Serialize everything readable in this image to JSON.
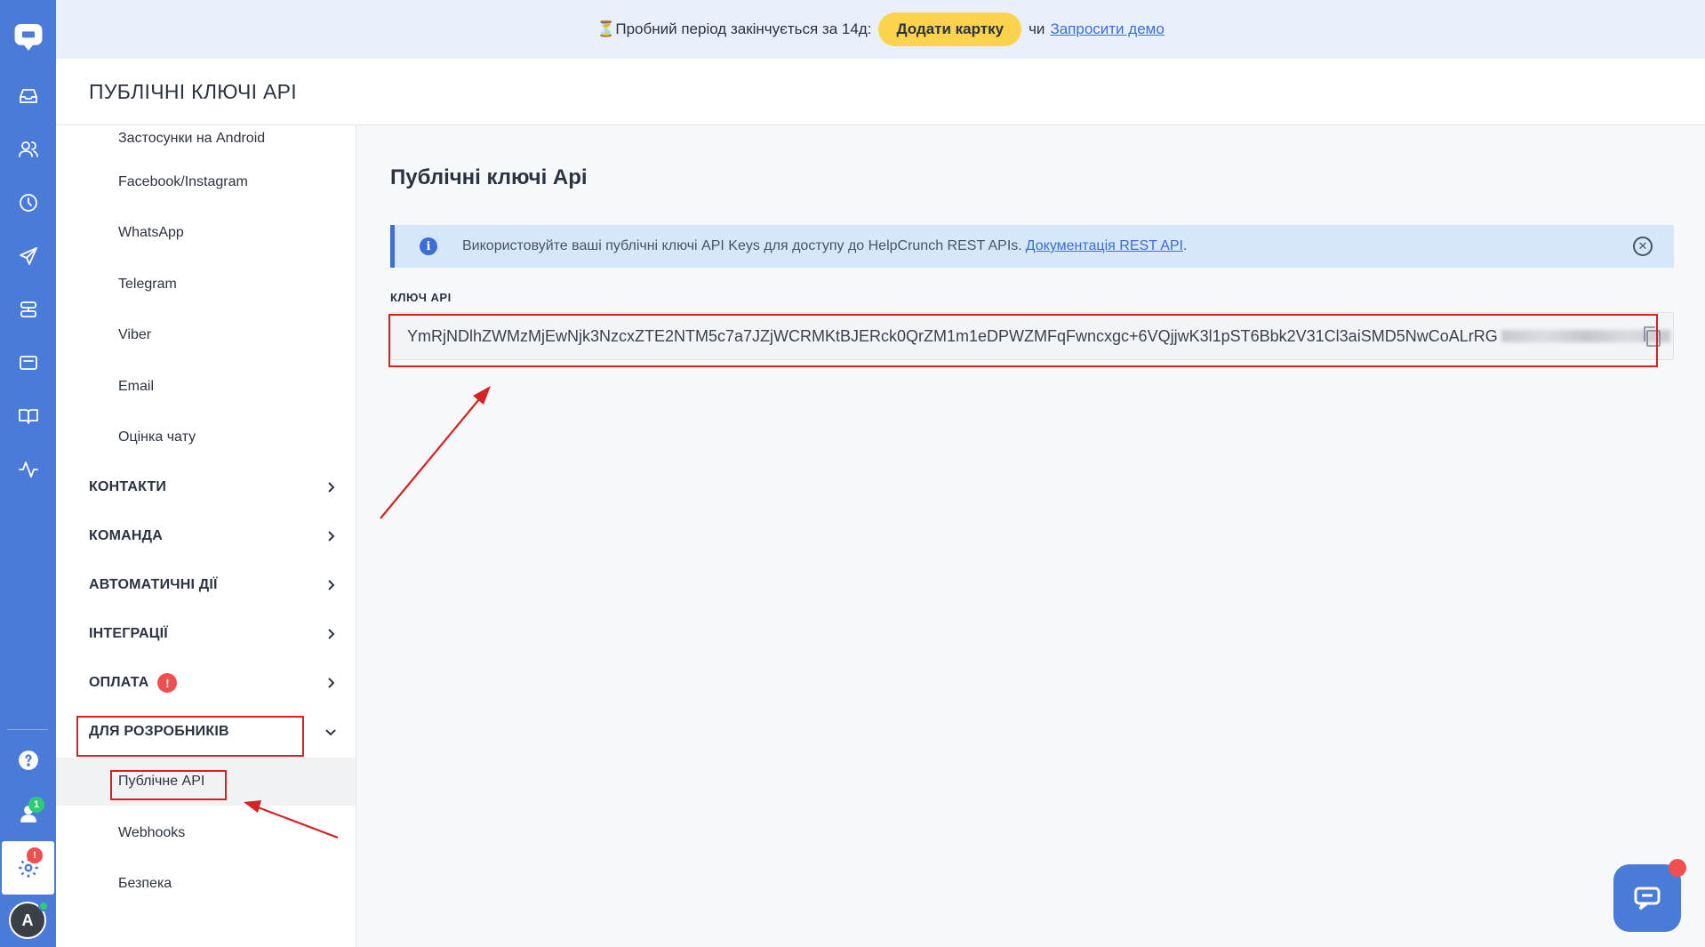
{
  "topbar": {
    "trial_text": "⏳Пробний період закінчується за 14д:",
    "add_card_label": "Додати картку",
    "or_text": "чи",
    "demo_link": "Запросити демо"
  },
  "page_header": {
    "title": "ПУБЛІЧНІ КЛЮЧІ API"
  },
  "rail": {
    "icons": [
      "logo-chat-icon",
      "inbox-icon",
      "contacts-icon",
      "history-icon",
      "send-icon",
      "automation-icon",
      "widget-icon",
      "knowledge-base-icon",
      "analytics-icon",
      "help-icon",
      "team-icon",
      "settings-icon"
    ],
    "team_badge": "1",
    "settings_badge": "!",
    "avatar_letter": "A"
  },
  "sidebar": {
    "subitems_top": [
      "Застосунки на Android",
      "Facebook/Instagram",
      "WhatsApp",
      "Telegram",
      "Viber",
      "Email",
      "Оцінка чату"
    ],
    "sections": [
      {
        "label": "КОНТАКТИ"
      },
      {
        "label": "КОМАНДА"
      },
      {
        "label": "АВТОМАТИЧНІ ДІЇ"
      },
      {
        "label": "ІНТЕГРАЦІЇ"
      },
      {
        "label": "ОПЛАТА",
        "badge": "!"
      },
      {
        "label": "ДЛЯ РОЗРОБНИКІВ"
      }
    ],
    "dev_items": [
      "Публічне API",
      "Webhooks",
      "Безпека"
    ]
  },
  "content": {
    "title": "Публічні ключі Api",
    "banner_text": "Використовуйте ваші публічні ключі API Keys для доступу до HelpCrunch REST APIs.",
    "banner_link": "Документація REST API",
    "banner_link_suffix": ".",
    "key_label": "КЛЮЧ API",
    "key_value": "YmRjNDlhZWMzMjEwNjk3NzcxZTE2NTM5c7a7JZjWCRMKtBJERck0QrZM1m1eDPWZMFqFwncxgc+6VQjjwK3l1pST6Bbk2V31Cl3aiSMD5NwCoALrRG"
  },
  "colors": {
    "rail": "#4a7bd8",
    "accent": "#3b6fd1",
    "trial_button": "#fcd34d",
    "highlight": "#d42222"
  }
}
